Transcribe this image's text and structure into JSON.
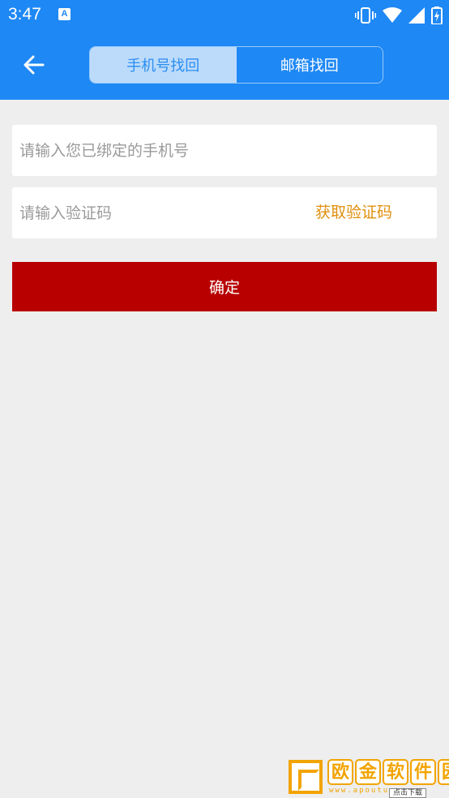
{
  "status_bar": {
    "time": "3:47",
    "notification_icon": "a-letter-icon",
    "icons": [
      "vibrate-icon",
      "wifi-icon",
      "signal-icon",
      "battery-icon"
    ]
  },
  "app_bar": {
    "back_icon": "arrow-left-icon",
    "tabs": [
      {
        "label": "手机号找回",
        "active": true
      },
      {
        "label": "邮箱找回",
        "active": false
      }
    ]
  },
  "form": {
    "phone_placeholder": "请输入您已绑定的手机号",
    "phone_value": "",
    "code_placeholder": "请输入验证码",
    "code_value": "",
    "get_code_label": "获取验证码",
    "confirm_label": "确定"
  },
  "watermark": {
    "chars": [
      "欧",
      "金",
      "软",
      "件",
      "园"
    ],
    "url": "www.apoutu.com",
    "badge": "点击下载"
  },
  "colors": {
    "primary": "#1e88f5",
    "confirm_button": "#b80000",
    "get_code_text": "#e0900e",
    "background": "#eeeeee"
  }
}
